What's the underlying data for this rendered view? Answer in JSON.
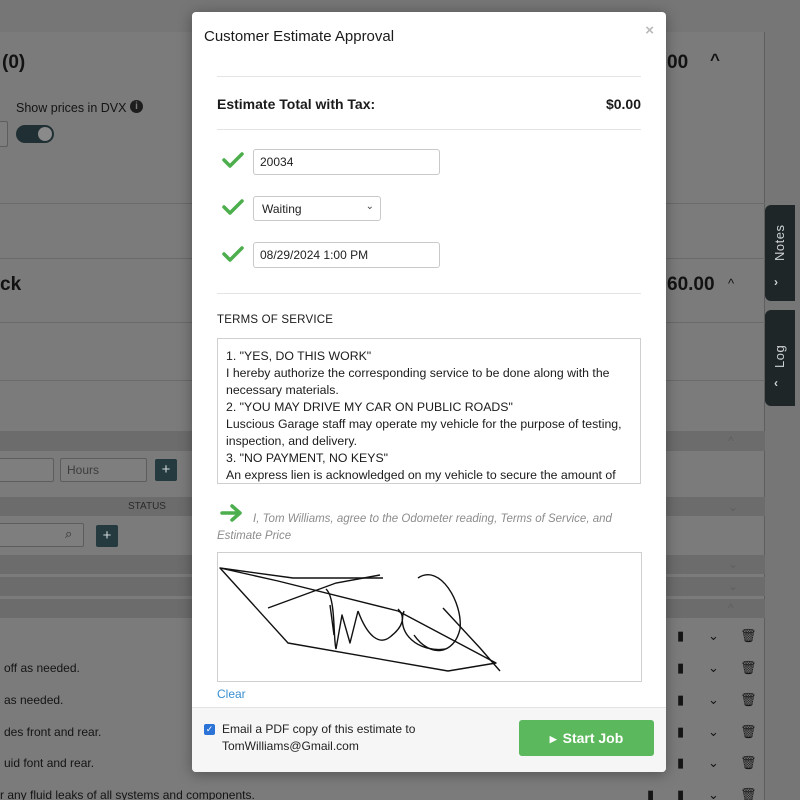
{
  "background": {
    "header_fragment": "(0)",
    "header_amount_fragment": "00",
    "show_prices_label": "Show prices in DVX",
    "info_icon": "info-icon",
    "section_fragment": "ck",
    "section_amount_fragment": "60.00",
    "hours_placeholder": "Hours",
    "status_column": "STATUS",
    "plus_label": "+",
    "row_texts": [
      "off as needed.",
      "as needed.",
      "des front and rear.",
      "uid font and rear.",
      "r any fluid leaks of all systems and components."
    ]
  },
  "side_tabs": {
    "notes_label": "Notes",
    "log_label": "Log"
  },
  "modal": {
    "title": "Customer Estimate Approval",
    "close_icon": "close-icon",
    "estimate_total_label": "Estimate Total with Tax:",
    "estimate_total_value": "$0.00",
    "fields": {
      "odometer": "20034",
      "status_selected": "Waiting",
      "datetime": "08/29/2024 1:00 PM"
    },
    "terms_title": "TERMS OF SERVICE",
    "terms_lines": [
      "1. \"YES, DO THIS WORK\"",
      "I hereby authorize the corresponding service to be done along with the necessary materials.",
      "2. \"YOU MAY DRIVE MY CAR ON PUBLIC ROADS\"",
      "Luscious Garage staff may operate my vehicle for the purpose of testing, inspection, and delivery.",
      "3. \"NO PAYMENT, NO KEYS\"",
      "An express lien is acknowledged on my vehicle to secure the amount of"
    ],
    "agreement_text": "I, Tom Williams, agree to the Odometer reading, Terms of Service, and Estimate Price",
    "clear_label": "Clear",
    "email_checkbox_checked": true,
    "email_text_line1": "Email a PDF copy of this estimate to",
    "email_text_line2": "TomWilliams@Gmail.com",
    "start_job_label": "Start Job"
  },
  "colors": {
    "check_green": "#4cae4c",
    "start_button": "#5cb85c",
    "link_blue": "#3a8fd0",
    "checkbox_blue": "#2b73d6"
  }
}
